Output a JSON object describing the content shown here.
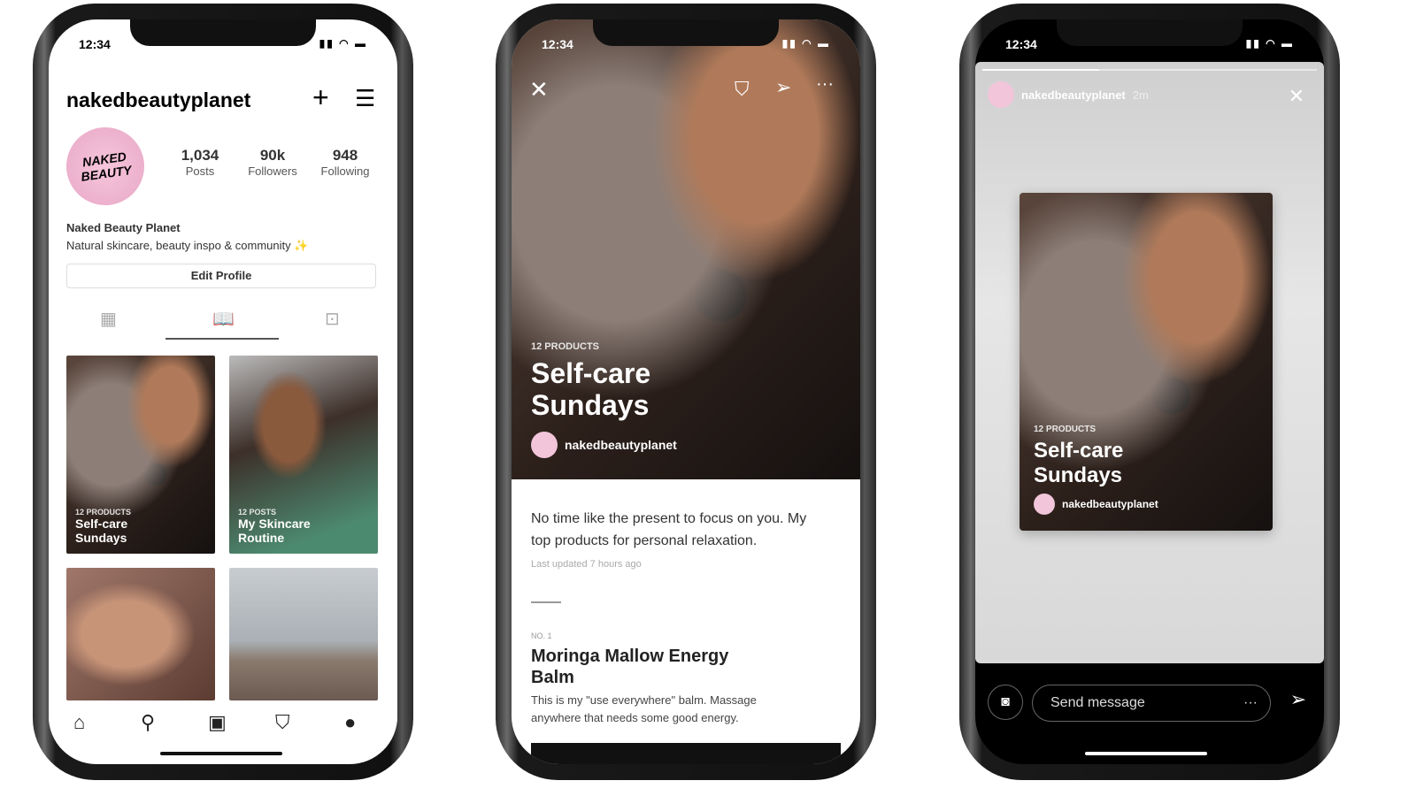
{
  "status_time": "12:34",
  "profile": {
    "username": "nakedbeautyplanet",
    "stats": [
      {
        "value": "1,034",
        "label": "Posts"
      },
      {
        "value": "90k",
        "label": "Followers"
      },
      {
        "value": "948",
        "label": "Following"
      }
    ],
    "name": "Naked Beauty Planet",
    "bio": "Natural skincare, beauty inspo & community ✨",
    "edit_label": "Edit Profile",
    "avatar_text": "NAKED BEAUTY",
    "guides": [
      {
        "eyebrow": "12 PRODUCTS",
        "title": "Self-care Sundays"
      },
      {
        "eyebrow": "12 POSTS",
        "title": "My Skincare Routine"
      }
    ],
    "active_tab": "guides"
  },
  "guide": {
    "eyebrow": "12 PRODUCTS",
    "title": "Self-care Sundays",
    "author": "nakedbeautyplanet",
    "description": "No time like the present to focus on you. My top products for personal relaxation.",
    "updated": "Last updated 7 hours ago",
    "item_number": "NO. 1",
    "item_title": "Moringa Mallow Energy Balm",
    "item_text": "This is my \"use everywhere\" balm. Massage anywhere that needs some good energy."
  },
  "story": {
    "username": "nakedbeautyplanet",
    "time": "2m",
    "progress": 0.35,
    "eyebrow": "12 PRODUCTS",
    "title": "Self-care Sundays",
    "author": "nakedbeautyplanet",
    "message_placeholder": "Send message"
  }
}
